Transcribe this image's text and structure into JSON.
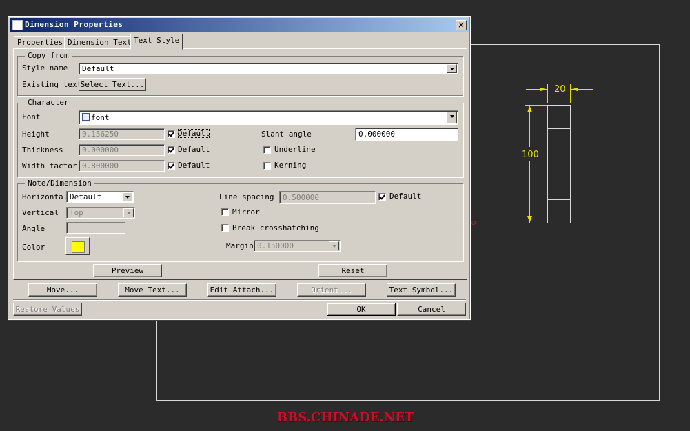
{
  "dialog": {
    "title": "Dimension Properties",
    "close": "×"
  },
  "tabs": [
    "Properties",
    "Dimension Text",
    "Text Style"
  ],
  "active_tab": "Text Style",
  "copy_from": {
    "legend": "Copy from",
    "style_name_label": "Style name",
    "style_name_value": "Default",
    "existing_text_label": "Existing text",
    "select_text_button": "Select Text..."
  },
  "character": {
    "legend": "Character",
    "font_label": "Font",
    "font_value": "font",
    "height_label": "Height",
    "height_value": "0.156250",
    "height_default_checked": true,
    "thickness_label": "Thickness",
    "thickness_value": "0.000000",
    "thickness_default_checked": true,
    "width_factor_label": "Width factor",
    "width_factor_value": "0.800000",
    "width_factor_default_checked": true,
    "default_label": "Default",
    "slant_angle_label": "Slant angle",
    "slant_angle_value": "0.000000",
    "underline_label": "Underline",
    "underline_checked": false,
    "kerning_label": "Kerning",
    "kerning_checked": false
  },
  "note_dimension": {
    "legend": "Note/Dimension",
    "horizontal_label": "Horizontal",
    "horizontal_value": "Default",
    "vertical_label": "Vertical",
    "vertical_value": "Top",
    "angle_label": "Angle",
    "angle_value": "",
    "color_label": "Color",
    "color_value": "#ffff00",
    "line_spacing_label": "Line spacing",
    "line_spacing_value": "0.500000",
    "line_spacing_default_checked": true,
    "default_label": "Default",
    "mirror_label": "Mirror",
    "mirror_checked": false,
    "break_crosshatching_label": "Break crosshatching",
    "break_crosshatching_checked": false,
    "margin_label": "Margin",
    "margin_value": "0.150000"
  },
  "panel_buttons": {
    "preview": "Preview",
    "reset": "Reset"
  },
  "action_buttons": {
    "move": "Move...",
    "move_text": "Move Text...",
    "edit_attach": "Edit Attach...",
    "orient": "Orient...",
    "text_symbol": "Text Symbol..."
  },
  "footer": {
    "restore_values": "Restore Values",
    "ok": "OK",
    "cancel": "Cancel"
  },
  "drawing": {
    "dim_horizontal": "20",
    "dim_vertical": "100",
    "dimension_color": "#e6e000"
  },
  "watermark": "BBS.CHINADE.NET"
}
